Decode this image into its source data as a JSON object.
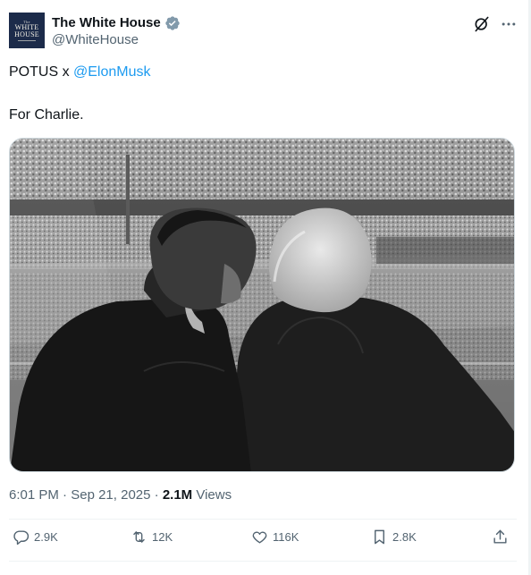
{
  "author": {
    "display_name": "The White House",
    "handle": "@WhiteHouse",
    "avatar_lines": [
      "The",
      "WHITE",
      "HOUSE"
    ]
  },
  "tweet": {
    "line1_prefix": "POTUS x ",
    "line1_mention": "@ElonMusk",
    "line2": "For Charlie."
  },
  "meta": {
    "time": "6:01 PM",
    "sep": " · ",
    "date": "Sep 21, 2025",
    "sep2": " · ",
    "views_count": "2.1M",
    "views_label": " Views"
  },
  "actions": {
    "replies": "2.9K",
    "reposts": "12K",
    "likes": "116K",
    "bookmarks": "2.8K"
  },
  "colors": {
    "accent": "#1d9bf0",
    "muted": "#536471",
    "text": "#0f1419"
  },
  "icons": [
    "verified-badge-icon",
    "grok-icon",
    "more-icon",
    "reply-icon",
    "repost-icon",
    "like-icon",
    "bookmark-icon",
    "share-icon"
  ]
}
